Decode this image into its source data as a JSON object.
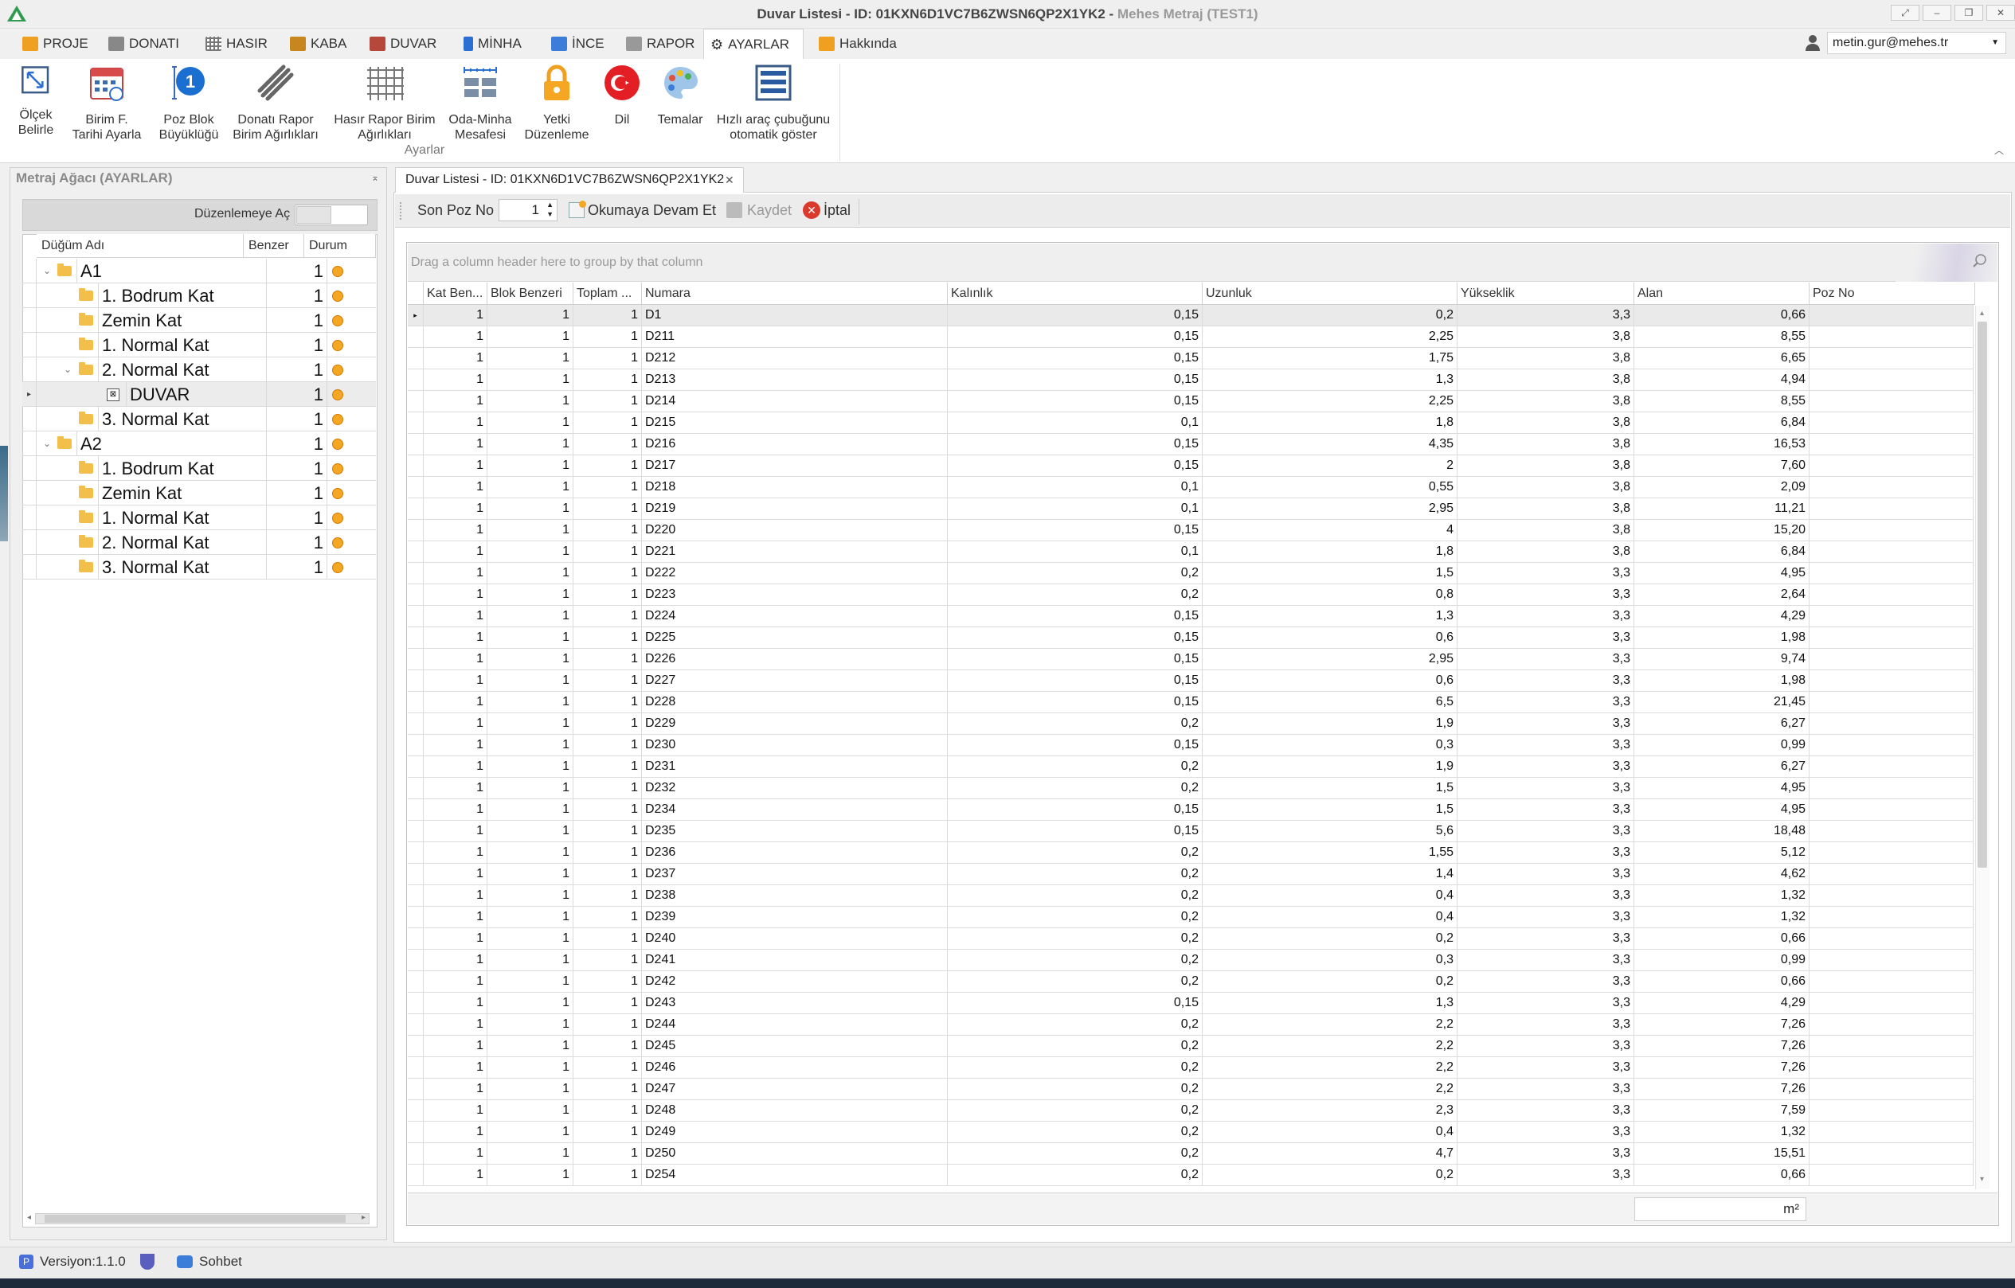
{
  "window": {
    "title_main": "Duvar Listesi - ID: 01KXN6D1VC7B6ZWSN6QP2X1YK2 -",
    "title_app": "Mehes Metraj (TEST1)"
  },
  "ribbon": {
    "tabs": [
      {
        "label": "PROJE",
        "color": "#f0a020"
      },
      {
        "label": "DONATI",
        "color": "#777777"
      },
      {
        "label": "HASIR",
        "color": "#666666"
      },
      {
        "label": "KABA",
        "color": "#c8861f"
      },
      {
        "label": "DUVAR",
        "color": "#b5483a"
      },
      {
        "label": "MİNHA",
        "color": "#2a6fd1"
      },
      {
        "label": "İNCE",
        "color": "#3b7dd8"
      },
      {
        "label": "RAPOR",
        "color": "#888888"
      },
      {
        "label": "AYARLAR",
        "color": "#555555"
      },
      {
        "label": "Hakkında",
        "color": "#f0a020"
      }
    ],
    "buttons": [
      {
        "label": "Ölçek\nBelirle"
      },
      {
        "label": "Birim F.\nTarihi Ayarla"
      },
      {
        "label": "Poz Blok\nBüyüklüğü"
      },
      {
        "label": "Donatı Rapor\nBirim Ağırlıkları"
      },
      {
        "label": "Hasır Rapor Birim\nAğırlıkları"
      },
      {
        "label": "Oda-Minha\nMesafesi"
      },
      {
        "label": "Yetki\nDüzenleme"
      },
      {
        "label": "Dil"
      },
      {
        "label": "Temalar"
      },
      {
        "label": "Hızlı araç çubuğunu\notomatik göster"
      }
    ],
    "group_label": "Ayarlar",
    "user": "metin.gur@mehes.tr"
  },
  "left_panel": {
    "title": "Metraj Ağacı (AYARLAR)",
    "edit_toggle_label": "Düzenlemeye Aç",
    "columns": {
      "name": "Düğüm Adı",
      "benzer": "Benzer",
      "durum": "Durum"
    },
    "nodes": [
      {
        "name": "A1",
        "benzer": "1",
        "level": 0,
        "expanded": true
      },
      {
        "name": "1. Bodrum Kat",
        "benzer": "1",
        "level": 1
      },
      {
        "name": "Zemin Kat",
        "benzer": "1",
        "level": 1
      },
      {
        "name": "1. Normal Kat",
        "benzer": "1",
        "level": 1
      },
      {
        "name": "2. Normal Kat",
        "benzer": "1",
        "level": 1,
        "expanded": true
      },
      {
        "name": "DUVAR",
        "benzer": "1",
        "level": 2,
        "selected": true
      },
      {
        "name": "3. Normal Kat",
        "benzer": "1",
        "level": 1
      },
      {
        "name": "A2",
        "benzer": "1",
        "level": 0,
        "expanded": true
      },
      {
        "name": "1. Bodrum Kat",
        "benzer": "1",
        "level": 1
      },
      {
        "name": "Zemin Kat",
        "benzer": "1",
        "level": 1
      },
      {
        "name": "1. Normal Kat",
        "benzer": "1",
        "level": 1
      },
      {
        "name": "2. Normal Kat",
        "benzer": "1",
        "level": 1
      },
      {
        "name": "3. Normal Kat",
        "benzer": "1",
        "level": 1
      }
    ]
  },
  "document": {
    "tab_label": "Duvar Listesi - ID: 01KXN6D1VC7B6ZWSN6QP2X1YK2",
    "toolbar": {
      "son_poz_label": "Son Poz No",
      "son_poz_value": "1",
      "continue_label": "Okumaya Devam Et",
      "save_label": "Kaydet",
      "cancel_label": "İptal"
    },
    "group_hint": "Drag a column header here to group by that column",
    "columns": [
      "Kat Ben...",
      "Blok Benzeri",
      "Toplam ...",
      "Numara",
      "Kalınlık",
      "Uzunluk",
      "Yükseklik",
      "Alan",
      "Poz No"
    ],
    "rows": [
      [
        "1",
        "1",
        "1",
        "D1",
        "0,15",
        "0,2",
        "3,3",
        "0,66",
        ""
      ],
      [
        "1",
        "1",
        "1",
        "D211",
        "0,15",
        "2,25",
        "3,8",
        "8,55",
        ""
      ],
      [
        "1",
        "1",
        "1",
        "D212",
        "0,15",
        "1,75",
        "3,8",
        "6,65",
        ""
      ],
      [
        "1",
        "1",
        "1",
        "D213",
        "0,15",
        "1,3",
        "3,8",
        "4,94",
        ""
      ],
      [
        "1",
        "1",
        "1",
        "D214",
        "0,15",
        "2,25",
        "3,8",
        "8,55",
        ""
      ],
      [
        "1",
        "1",
        "1",
        "D215",
        "0,1",
        "1,8",
        "3,8",
        "6,84",
        ""
      ],
      [
        "1",
        "1",
        "1",
        "D216",
        "0,15",
        "4,35",
        "3,8",
        "16,53",
        ""
      ],
      [
        "1",
        "1",
        "1",
        "D217",
        "0,15",
        "2",
        "3,8",
        "7,60",
        ""
      ],
      [
        "1",
        "1",
        "1",
        "D218",
        "0,1",
        "0,55",
        "3,8",
        "2,09",
        ""
      ],
      [
        "1",
        "1",
        "1",
        "D219",
        "0,1",
        "2,95",
        "3,8",
        "11,21",
        ""
      ],
      [
        "1",
        "1",
        "1",
        "D220",
        "0,15",
        "4",
        "3,8",
        "15,20",
        ""
      ],
      [
        "1",
        "1",
        "1",
        "D221",
        "0,1",
        "1,8",
        "3,8",
        "6,84",
        ""
      ],
      [
        "1",
        "1",
        "1",
        "D222",
        "0,2",
        "1,5",
        "3,3",
        "4,95",
        ""
      ],
      [
        "1",
        "1",
        "1",
        "D223",
        "0,2",
        "0,8",
        "3,3",
        "2,64",
        ""
      ],
      [
        "1",
        "1",
        "1",
        "D224",
        "0,15",
        "1,3",
        "3,3",
        "4,29",
        ""
      ],
      [
        "1",
        "1",
        "1",
        "D225",
        "0,15",
        "0,6",
        "3,3",
        "1,98",
        ""
      ],
      [
        "1",
        "1",
        "1",
        "D226",
        "0,15",
        "2,95",
        "3,3",
        "9,74",
        ""
      ],
      [
        "1",
        "1",
        "1",
        "D227",
        "0,15",
        "0,6",
        "3,3",
        "1,98",
        ""
      ],
      [
        "1",
        "1",
        "1",
        "D228",
        "0,15",
        "6,5",
        "3,3",
        "21,45",
        ""
      ],
      [
        "1",
        "1",
        "1",
        "D229",
        "0,2",
        "1,9",
        "3,3",
        "6,27",
        ""
      ],
      [
        "1",
        "1",
        "1",
        "D230",
        "0,15",
        "0,3",
        "3,3",
        "0,99",
        ""
      ],
      [
        "1",
        "1",
        "1",
        "D231",
        "0,2",
        "1,9",
        "3,3",
        "6,27",
        ""
      ],
      [
        "1",
        "1",
        "1",
        "D232",
        "0,2",
        "1,5",
        "3,3",
        "4,95",
        ""
      ],
      [
        "1",
        "1",
        "1",
        "D234",
        "0,15",
        "1,5",
        "3,3",
        "4,95",
        ""
      ],
      [
        "1",
        "1",
        "1",
        "D235",
        "0,15",
        "5,6",
        "3,3",
        "18,48",
        ""
      ],
      [
        "1",
        "1",
        "1",
        "D236",
        "0,2",
        "1,55",
        "3,3",
        "5,12",
        ""
      ],
      [
        "1",
        "1",
        "1",
        "D237",
        "0,2",
        "1,4",
        "3,3",
        "4,62",
        ""
      ],
      [
        "1",
        "1",
        "1",
        "D238",
        "0,2",
        "0,4",
        "3,3",
        "1,32",
        ""
      ],
      [
        "1",
        "1",
        "1",
        "D239",
        "0,2",
        "0,4",
        "3,3",
        "1,32",
        ""
      ],
      [
        "1",
        "1",
        "1",
        "D240",
        "0,2",
        "0,2",
        "3,3",
        "0,66",
        ""
      ],
      [
        "1",
        "1",
        "1",
        "D241",
        "0,2",
        "0,3",
        "3,3",
        "0,99",
        ""
      ],
      [
        "1",
        "1",
        "1",
        "D242",
        "0,2",
        "0,2",
        "3,3",
        "0,66",
        ""
      ],
      [
        "1",
        "1",
        "1",
        "D243",
        "0,15",
        "1,3",
        "3,3",
        "4,29",
        ""
      ],
      [
        "1",
        "1",
        "1",
        "D244",
        "0,2",
        "2,2",
        "3,3",
        "7,26",
        ""
      ],
      [
        "1",
        "1",
        "1",
        "D245",
        "0,2",
        "2,2",
        "3,3",
        "7,26",
        ""
      ],
      [
        "1",
        "1",
        "1",
        "D246",
        "0,2",
        "2,2",
        "3,3",
        "7,26",
        ""
      ],
      [
        "1",
        "1",
        "1",
        "D247",
        "0,2",
        "2,2",
        "3,3",
        "7,26",
        ""
      ],
      [
        "1",
        "1",
        "1",
        "D248",
        "0,2",
        "2,3",
        "3,3",
        "7,59",
        ""
      ],
      [
        "1",
        "1",
        "1",
        "D249",
        "0,2",
        "0,4",
        "3,3",
        "1,32",
        ""
      ],
      [
        "1",
        "1",
        "1",
        "D250",
        "0,2",
        "4,7",
        "3,3",
        "15,51",
        ""
      ],
      [
        "1",
        "1",
        "1",
        "D254",
        "0,2",
        "0,2",
        "3,3",
        "0,66",
        ""
      ]
    ],
    "footer_alan": "m²"
  },
  "statusbar": {
    "version": "Versiyon:1.1.0",
    "chat": "Sohbet"
  }
}
